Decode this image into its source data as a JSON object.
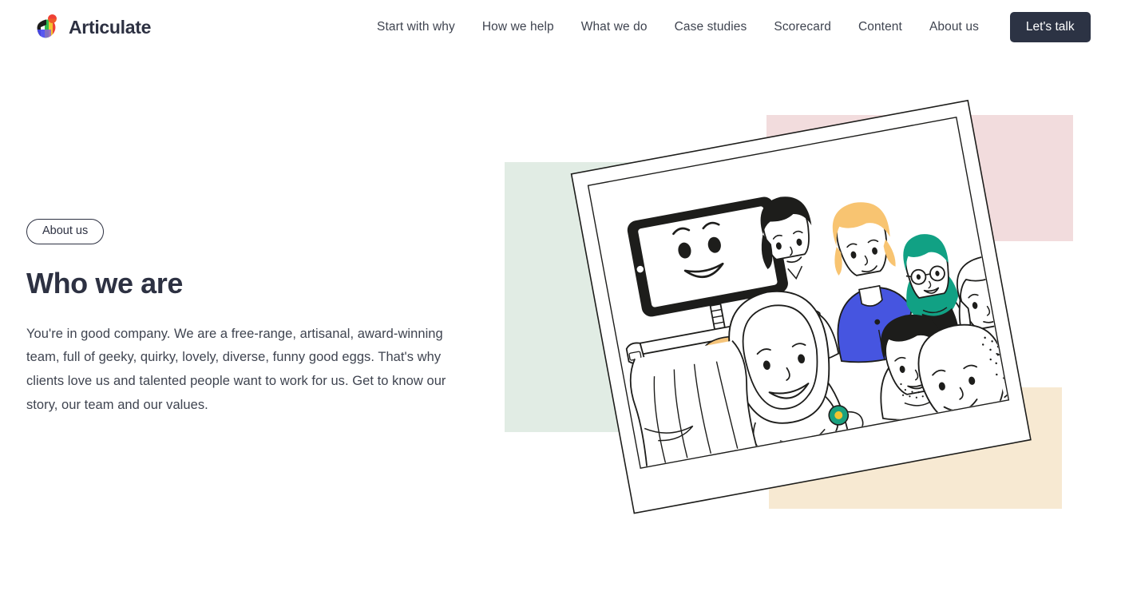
{
  "header": {
    "brand": {
      "name": "Articulate",
      "logo_icon": "articulate-leaf-logo"
    },
    "nav": [
      {
        "label": "Start with why"
      },
      {
        "label": "How we help"
      },
      {
        "label": "What we do"
      },
      {
        "label": "Case studies"
      },
      {
        "label": "Scorecard"
      },
      {
        "label": "Content"
      },
      {
        "label": "About us"
      }
    ],
    "cta": {
      "label": "Let's talk"
    }
  },
  "hero": {
    "eyebrow": "About us",
    "title": "Who we are",
    "body": "You're in good company. We are a free-range, artisanal, award-winning team, full of geeky, quirky, lovely, diverse, funny good eggs. That's why clients love us and talented people want to work for us. Get to know our story, our team and our values."
  },
  "illustration": {
    "alt": "Tilted photo frame of a smiling diverse team with a tablet robot",
    "blocks": {
      "green": "#e1ece4",
      "pink": "#f2dcdd",
      "beige": "#f7e9d2"
    },
    "accents": {
      "blue_shirt": "#4655e0",
      "green_shirt": "#12997b",
      "teal_hair": "#11a184",
      "blonde_hair": "#f8c471",
      "orange_badge": "#f5c47a",
      "green_badge": "#1aa17f",
      "outline": "#1d1d1b"
    }
  },
  "theme": {
    "ink": "#2d3142",
    "body_text": "#3f4450",
    "cta_bg": "#2c3344",
    "page_bg": "#ffffff"
  }
}
